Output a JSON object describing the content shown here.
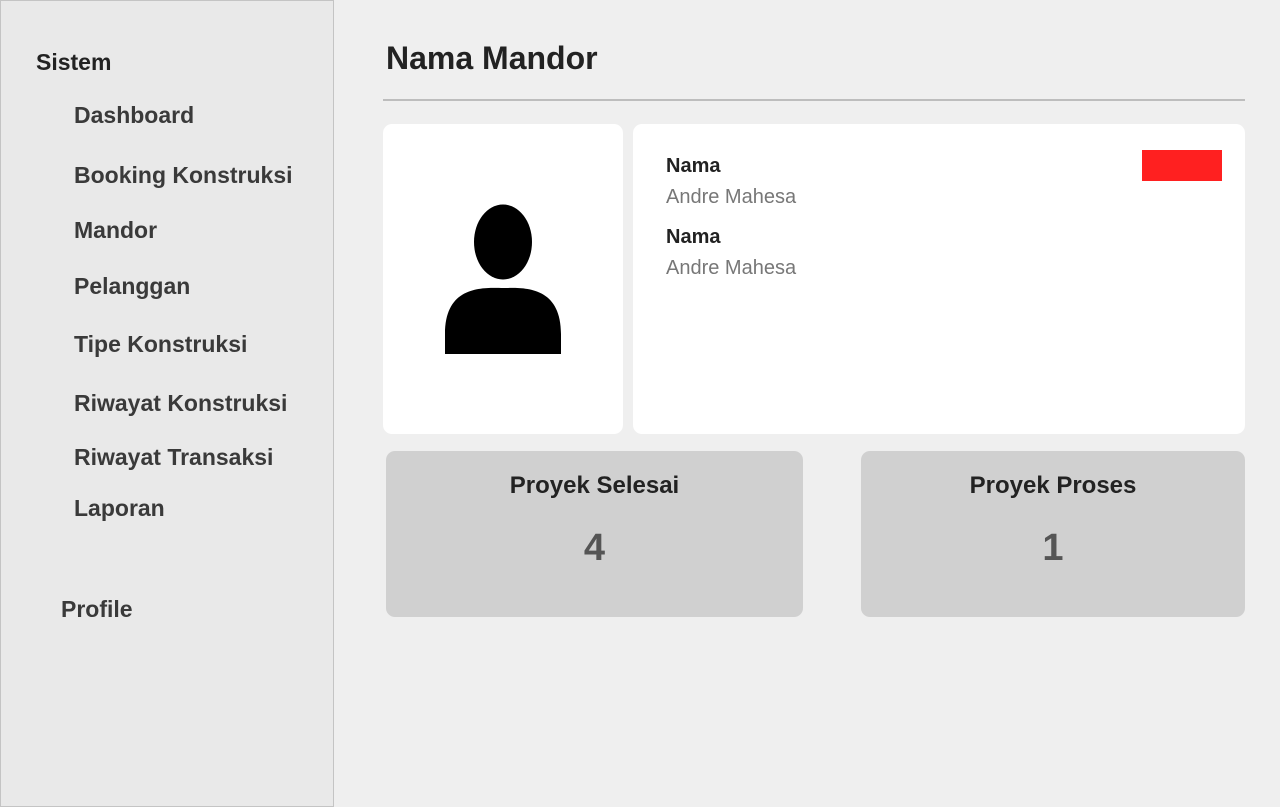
{
  "sidebar": {
    "section_title": "Sistem",
    "items": [
      {
        "label": "Dashboard"
      },
      {
        "label": "Booking Konstruksi"
      },
      {
        "label": "Mandor"
      },
      {
        "label": "Pelanggan"
      },
      {
        "label": "Tipe Konstruksi"
      },
      {
        "label": "Riwayat Konstruksi"
      },
      {
        "label": "Riwayat Transaksi"
      },
      {
        "label": "Laporan"
      }
    ],
    "profile_label": "Profile"
  },
  "header": {
    "title": "Nama Mandor"
  },
  "photo": {
    "icon": "user-silhouette-icon"
  },
  "info": {
    "fields": [
      {
        "label": "Nama",
        "value": "Andre Mahesa"
      },
      {
        "label": "Nama",
        "value": "Andre Mahesa"
      }
    ],
    "action_color": "#ff2020"
  },
  "stats": {
    "completed": {
      "label": "Proyek Selesai",
      "value": "4"
    },
    "in_progress": {
      "label": "Proyek Proses",
      "value": "1"
    }
  },
  "colors": {
    "background": "#efefef",
    "sidebar_background": "#e9e9e9",
    "card_background": "#ffffff",
    "stat_background": "#d0d0d0"
  }
}
